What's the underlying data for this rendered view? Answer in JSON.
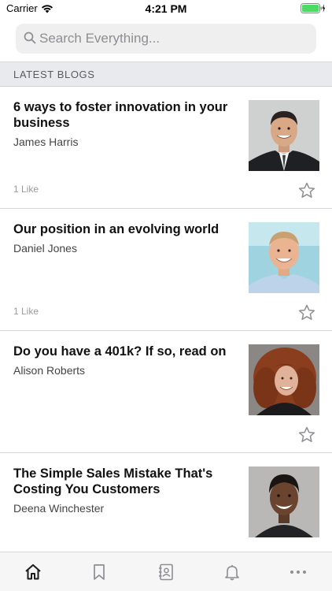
{
  "status_bar": {
    "carrier": "Carrier",
    "time": "4:21 PM",
    "battery_color": "#4cd964"
  },
  "search": {
    "placeholder": "Search Everything..."
  },
  "section": {
    "title": "LATEST BLOGS"
  },
  "posts": [
    {
      "title": "6 ways to foster innovation in your business",
      "author": "James Harris",
      "likes": "1 Like",
      "photo": "man-in-suit-photo"
    },
    {
      "title": "Our position in an evolving world",
      "author": "Daniel Jones",
      "likes": "1 Like",
      "photo": "man-smiling-photo"
    },
    {
      "title": "Do you have a 401k? If so, read on",
      "author": "Alison Roberts",
      "likes": "",
      "photo": "woman-curly-hair-photo"
    },
    {
      "title": "The Simple Sales Mistake That's Costing You Customers",
      "author": "Deena Winchester",
      "likes": "",
      "photo": "woman-smiling-photo"
    }
  ],
  "tab_bar": {
    "items": [
      "home-icon",
      "bookmark-icon",
      "contacts-icon",
      "bell-icon",
      "more-icon"
    ],
    "active_color": "#1c1c1e",
    "inactive_color": "#8e8e93"
  }
}
